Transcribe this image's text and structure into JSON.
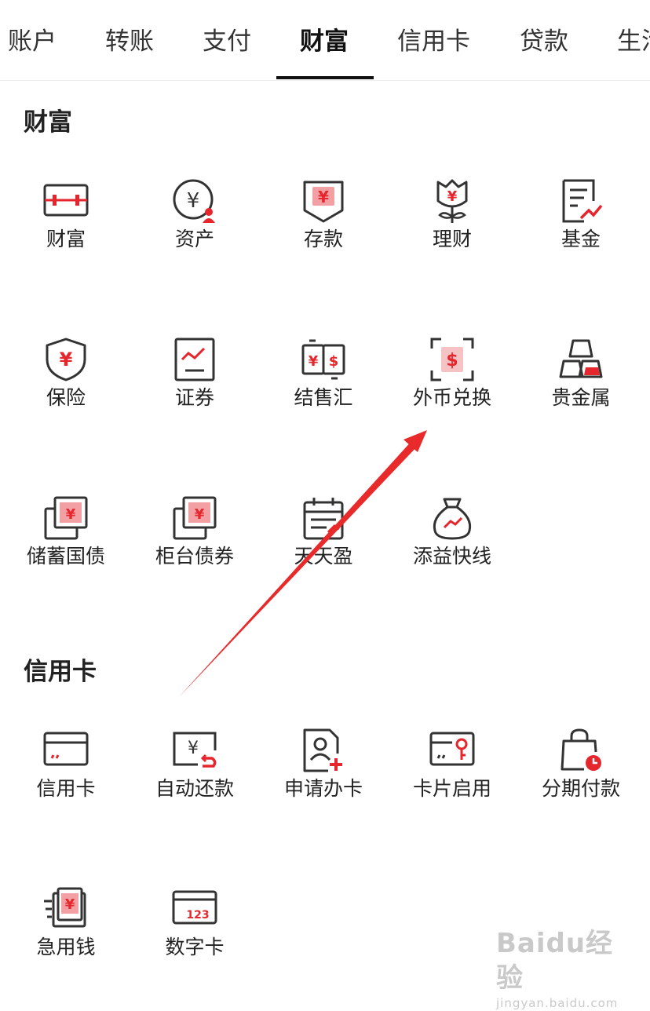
{
  "tabs": [
    {
      "label": "账户"
    },
    {
      "label": "转账"
    },
    {
      "label": "支付"
    },
    {
      "label": "财富",
      "active": true
    },
    {
      "label": "信用卡"
    },
    {
      "label": "贷款"
    },
    {
      "label": "生活"
    }
  ],
  "sections": [
    {
      "title": "财富",
      "items": [
        {
          "label": "财富",
          "icon": "wealth-box-icon"
        },
        {
          "label": "资产",
          "icon": "yuan-user-icon"
        },
        {
          "label": "存款",
          "icon": "deposit-icon"
        },
        {
          "label": "理财",
          "icon": "flower-yuan-icon"
        },
        {
          "label": "基金",
          "icon": "fund-document-icon"
        },
        {
          "label": "保险",
          "icon": "shield-yuan-icon"
        },
        {
          "label": "证券",
          "icon": "securities-chart-icon"
        },
        {
          "label": "结售汇",
          "icon": "exchange-settlement-icon"
        },
        {
          "label": "外币兑换",
          "icon": "dollar-scan-icon"
        },
        {
          "label": "贵金属",
          "icon": "gold-bars-icon"
        },
        {
          "label": "储蓄国债",
          "icon": "bond-stack-icon"
        },
        {
          "label": "柜台债券",
          "icon": "counter-bond-icon"
        },
        {
          "label": "天天盈",
          "icon": "calendar-icon"
        },
        {
          "label": "添益快线",
          "icon": "money-bag-icon"
        }
      ]
    },
    {
      "title": "信用卡",
      "items": [
        {
          "label": "信用卡",
          "icon": "credit-card-icon"
        },
        {
          "label": "自动还款",
          "icon": "auto-repay-icon"
        },
        {
          "label": "申请办卡",
          "icon": "apply-card-icon"
        },
        {
          "label": "卡片启用",
          "icon": "card-activate-icon"
        },
        {
          "label": "分期付款",
          "icon": "installment-bag-icon"
        },
        {
          "label": "急用钱",
          "icon": "urgent-cash-icon"
        },
        {
          "label": "数字卡",
          "icon": "digital-card-icon"
        }
      ]
    }
  ],
  "digital_card_number": "123",
  "watermark": {
    "main": "Baidu经验",
    "sub": "jingyan.baidu.com"
  },
  "colors": {
    "accent": "#e5262d",
    "text": "#222222",
    "ink": "#333333"
  }
}
